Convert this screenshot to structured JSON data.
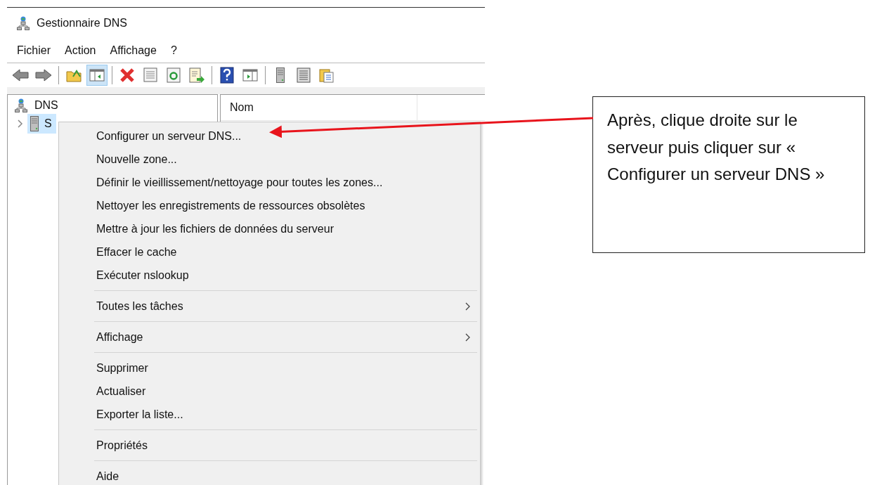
{
  "window": {
    "title": "Gestionnaire DNS"
  },
  "menubar": [
    "Fichier",
    "Action",
    "Affichage",
    "?"
  ],
  "toolbar": [
    {
      "kind": "back",
      "pressed": false
    },
    {
      "kind": "forward",
      "pressed": false
    },
    {
      "kind": "separator"
    },
    {
      "kind": "folder-up",
      "pressed": false
    },
    {
      "kind": "console-tree",
      "pressed": true
    },
    {
      "kind": "separator"
    },
    {
      "kind": "delete",
      "pressed": false
    },
    {
      "kind": "properties",
      "pressed": false
    },
    {
      "kind": "refresh",
      "pressed": false
    },
    {
      "kind": "export",
      "pressed": false
    },
    {
      "kind": "separator"
    },
    {
      "kind": "help",
      "pressed": false
    },
    {
      "kind": "action-pane",
      "pressed": false
    },
    {
      "kind": "separator"
    },
    {
      "kind": "server",
      "pressed": false
    },
    {
      "kind": "list",
      "pressed": false
    },
    {
      "kind": "clipboard",
      "pressed": false
    }
  ],
  "tree": {
    "label": "DNS",
    "children": [
      {
        "label": "S",
        "selected": true,
        "expanded": false
      }
    ]
  },
  "list": {
    "columns": [
      "Nom"
    ]
  },
  "context_menu": [
    [
      {
        "label": "Configurer un serveur DNS...",
        "submenu": false
      },
      {
        "label": "Nouvelle zone...",
        "submenu": false
      },
      {
        "label": "Définir le vieillissement/nettoyage pour toutes les zones...",
        "submenu": false
      },
      {
        "label": "Nettoyer les enregistrements de ressources obsolètes",
        "submenu": false
      },
      {
        "label": "Mettre à jour les fichiers de données du serveur",
        "submenu": false
      },
      {
        "label": "Effacer le cache",
        "submenu": false
      },
      {
        "label": "Exécuter nslookup",
        "submenu": false
      }
    ],
    [
      {
        "label": "Toutes les tâches",
        "submenu": true
      }
    ],
    [
      {
        "label": "Affichage",
        "submenu": true
      }
    ],
    [
      {
        "label": "Supprimer",
        "submenu": false
      },
      {
        "label": "Actualiser",
        "submenu": false
      },
      {
        "label": "Exporter la liste...",
        "submenu": false
      }
    ],
    [
      {
        "label": "Propriétés",
        "submenu": false
      }
    ],
    [
      {
        "label": "Aide",
        "submenu": false
      }
    ]
  ],
  "callout": {
    "text": "Après, clique droite sur le serveur puis cliquer sur « Configurer un serveur DNS »"
  }
}
